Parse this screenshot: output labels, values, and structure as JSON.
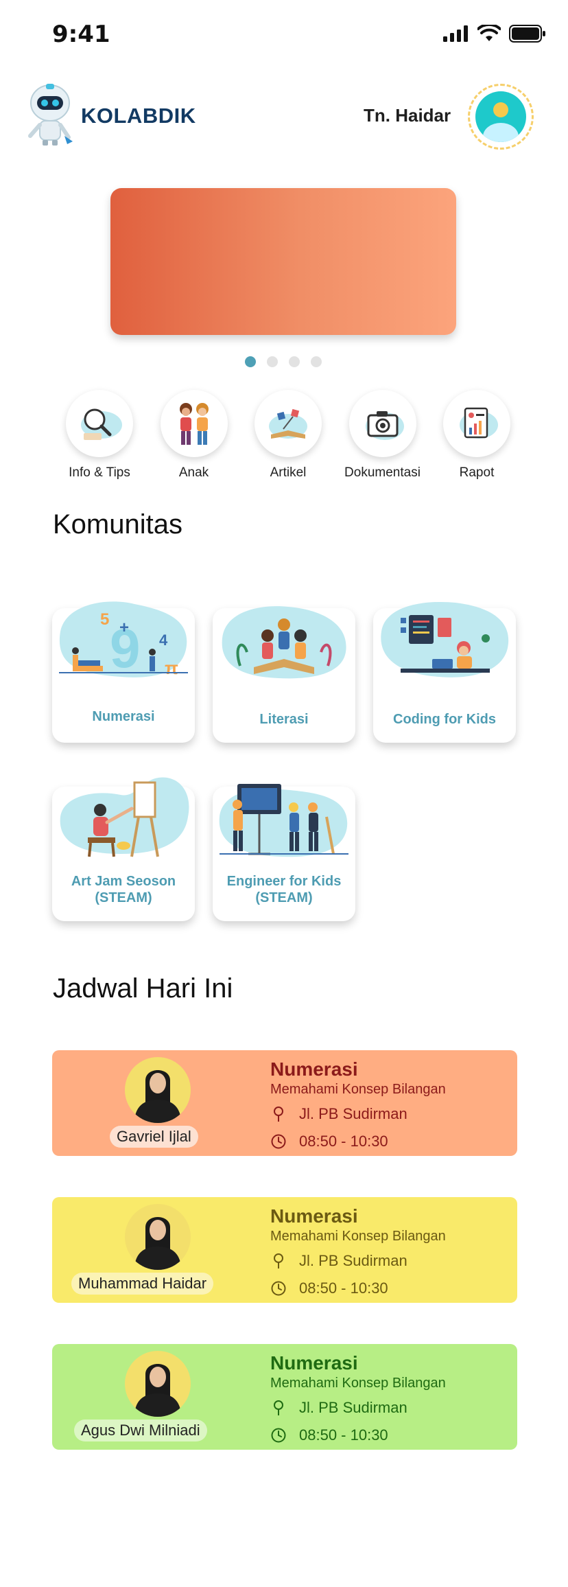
{
  "status_bar": {
    "time": "9:41"
  },
  "header": {
    "brand": "KOLABDIK",
    "user_name": "Tn. Haidar"
  },
  "banner": {
    "total_slides": 4,
    "active_slide": 1
  },
  "menu": [
    {
      "label": "Info & Tips",
      "icon": "info-tips-icon"
    },
    {
      "label": "Anak",
      "icon": "kids-icon"
    },
    {
      "label": "Artikel",
      "icon": "article-icon"
    },
    {
      "label": "Dokumentasi",
      "icon": "camera-icon"
    },
    {
      "label": "Rapot",
      "icon": "report-icon"
    }
  ],
  "komunitas": {
    "title": "Komunitas",
    "cards": [
      {
        "label": "Numerasi"
      },
      {
        "label": "Literasi"
      },
      {
        "label": "Coding for Kids"
      },
      {
        "label": "Art Jam Seoson\n(STEAM)"
      },
      {
        "label": "Engineer for Kids\n(STEAM)"
      }
    ]
  },
  "jadwal": {
    "title": "Jadwal Hari Ini",
    "items": [
      {
        "name": "Gavriel Ijlal",
        "subject": "Numerasi",
        "topic": "Memahami Konsep Bilangan",
        "location": "Jl. PB Sudirman",
        "time": "08:50 - 10:30",
        "bg": "#ffad82",
        "text_color": "#8b1a1a",
        "pill_bg": "#fde1d2"
      },
      {
        "name": "Muhammad Haidar",
        "subject": "Numerasi",
        "topic": "Memahami Konsep Bilangan",
        "location": "Jl. PB Sudirman",
        "time": "08:50 - 10:30",
        "bg": "#f9ea6a",
        "text_color": "#6b5a12",
        "pill_bg": "#fbf3b5"
      },
      {
        "name": "Agus Dwi Milniadi",
        "subject": "Numerasi",
        "topic": "Memahami Konsep Bilangan",
        "location": "Jl. PB Sudirman",
        "time": "08:50 - 10:30",
        "bg": "#b7ee85",
        "text_color": "#1f6b12",
        "pill_bg": "#dcf6c4"
      }
    ]
  },
  "colors": {
    "brand": "#123a63",
    "accent": "#4ea0b6"
  }
}
